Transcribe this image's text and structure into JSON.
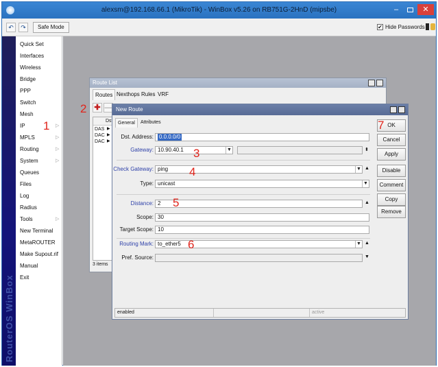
{
  "window": {
    "title": "alexsm@192.168.66.1 (MikroTik) - WinBox v5.26 on RB751G-2HnD (mipsbe)",
    "controls": {
      "minimize": "–",
      "close": "✕"
    }
  },
  "toolbar": {
    "back": "↶",
    "forward": "↷",
    "safe_mode": "Safe Mode",
    "hide_passwords": "Hide Passwords",
    "hide_passwords_checked": "✔"
  },
  "sidebar": {
    "brand": "RouterOS WinBox",
    "items": [
      {
        "label": "Quick Set",
        "arrow": ""
      },
      {
        "label": "Interfaces",
        "arrow": ""
      },
      {
        "label": "Wireless",
        "arrow": ""
      },
      {
        "label": "Bridge",
        "arrow": ""
      },
      {
        "label": "PPP",
        "arrow": ""
      },
      {
        "label": "Switch",
        "arrow": ""
      },
      {
        "label": "Mesh",
        "arrow": ""
      },
      {
        "label": "IP",
        "arrow": "▷"
      },
      {
        "label": "MPLS",
        "arrow": "▷"
      },
      {
        "label": "Routing",
        "arrow": "▷"
      },
      {
        "label": "System",
        "arrow": "▷"
      },
      {
        "label": "Queues",
        "arrow": ""
      },
      {
        "label": "Files",
        "arrow": ""
      },
      {
        "label": "Log",
        "arrow": ""
      },
      {
        "label": "Radius",
        "arrow": ""
      },
      {
        "label": "Tools",
        "arrow": "▷"
      },
      {
        "label": "New Terminal",
        "arrow": ""
      },
      {
        "label": "MetaROUTER",
        "arrow": ""
      },
      {
        "label": "Make Supout.rif",
        "arrow": ""
      },
      {
        "label": "Manual",
        "arrow": ""
      },
      {
        "label": "Exit",
        "arrow": ""
      }
    ]
  },
  "route_list": {
    "title": "Route List",
    "tabs": [
      "Routes",
      "Nexthops",
      "Rules",
      "VRF"
    ],
    "add": "✚",
    "remove": "—",
    "column": "Dst",
    "rows": [
      "DAS",
      "DAC",
      "DAC"
    ],
    "row_flag": "▶",
    "count": "3 items"
  },
  "new_route": {
    "title": "New Route",
    "tabs": [
      "General",
      "Attributes"
    ],
    "labels": {
      "dst_address": "Dst. Address:",
      "gateway": "Gateway:",
      "check_gateway": "Check Gateway:",
      "type": "Type:",
      "distance": "Distance:",
      "scope": "Scope:",
      "target_scope": "Target Scope:",
      "routing_mark": "Routing Mark:",
      "pref_source": "Pref. Source:"
    },
    "values": {
      "dst_address": "0.0.0.0/0",
      "gateway": "10.90.40.1",
      "check_gateway": "ping",
      "type": "unicast",
      "distance": "2",
      "scope": "30",
      "target_scope": "10",
      "routing_mark": "to_ether5",
      "pref_source": ""
    },
    "buttons": [
      "OK",
      "Cancel",
      "Apply",
      "Disable",
      "Comment",
      "Copy",
      "Remove"
    ],
    "status_left": "enabled",
    "status_right": "active",
    "glyphs": {
      "dropdown": "▼",
      "up": "▲",
      "down": "▼",
      "updown": "⬍"
    }
  },
  "annotations": [
    "1",
    "2",
    "3",
    "4",
    "5",
    "6",
    "7"
  ],
  "colors": {
    "title_bar": "#2a72c0",
    "sidebar": "#14147a",
    "annotation": "#e0241b",
    "link_label": "#2c3fa8"
  }
}
